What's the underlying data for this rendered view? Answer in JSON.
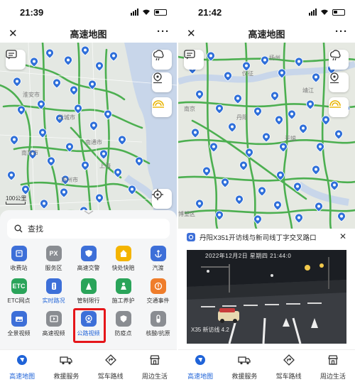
{
  "left": {
    "status_time": "21:39",
    "title": "高速地图",
    "scale_label": "100公里",
    "search_placeholder": "查找",
    "map_labels": [
      "淮安市",
      "盐城市",
      "泰州市",
      "南通市",
      "南京市",
      "苏州市",
      "常州市",
      "无锡市",
      "上海",
      "杭州市",
      "扬州"
    ],
    "services": [
      {
        "label": "收费站",
        "icon": "toll-station-icon",
        "color": "#3d6fd8"
      },
      {
        "label": "服务区",
        "icon": "service-area-icon",
        "color": "#8a8d92",
        "text": "PX"
      },
      {
        "label": "高速交警",
        "icon": "police-icon",
        "color": "#3d6fd8"
      },
      {
        "label": "快处快赔",
        "icon": "house-icon",
        "color": "#f4b400"
      },
      {
        "label": "汽渡",
        "icon": "anchor-icon",
        "color": "#3d6fd8"
      },
      {
        "label": "ETC网点",
        "icon": "etc-icon",
        "color": "#2aa45a",
        "text": "ETC"
      },
      {
        "label": "实时路况",
        "icon": "traffic-icon",
        "color": "#3d6fd8",
        "active": true
      },
      {
        "label": "管制限行",
        "icon": "cone-icon",
        "color": "#2aa45a"
      },
      {
        "label": "施工养护",
        "icon": "worker-icon",
        "color": "#2aa45a"
      },
      {
        "label": "交通事件",
        "icon": "event-icon",
        "color": "#ef7d2b"
      },
      {
        "label": "全景视频",
        "icon": "panorama-icon",
        "color": "#3d6fd8"
      },
      {
        "label": "高速视频",
        "icon": "video-icon",
        "color": "#8a8d92"
      },
      {
        "label": "公路视频",
        "icon": "camera-icon",
        "color": "#3d6fd8",
        "active": true,
        "highlight": true
      },
      {
        "label": "防疫点",
        "icon": "shield-icon",
        "color": "#8a8d92"
      },
      {
        "label": "核酸/抗原",
        "icon": "test-tube-icon",
        "color": "#8a8d92"
      }
    ]
  },
  "right": {
    "status_time": "21:42",
    "title": "高速地图",
    "map_labels": [
      "扬州",
      "仪征",
      "靖江",
      "镇江",
      "句容",
      "常州",
      "丹阳",
      "金坛",
      "溧阳",
      "宜兴",
      "无锡",
      "武进",
      "江阴",
      "南京",
      "马鞍山",
      "博望区"
    ],
    "video_title": "丹阳X351开访线与新司线丁字交叉路口",
    "video_osd_time": "2022年12月2日 星期四 21:44:0",
    "video_osd_road": "X35 新访线  4.2"
  },
  "tabs": [
    {
      "label": "高速地图",
      "icon": "map-icon",
      "on": true
    },
    {
      "label": "救援服务",
      "icon": "truck-icon"
    },
    {
      "label": "驾车路线",
      "icon": "route-icon"
    },
    {
      "label": "周边生活",
      "icon": "store-icon"
    }
  ],
  "colors": {
    "accent": "#1f63d8",
    "highlight_box": "#e5161a",
    "road": "#4caf50",
    "pin": "#2f6fd9"
  }
}
